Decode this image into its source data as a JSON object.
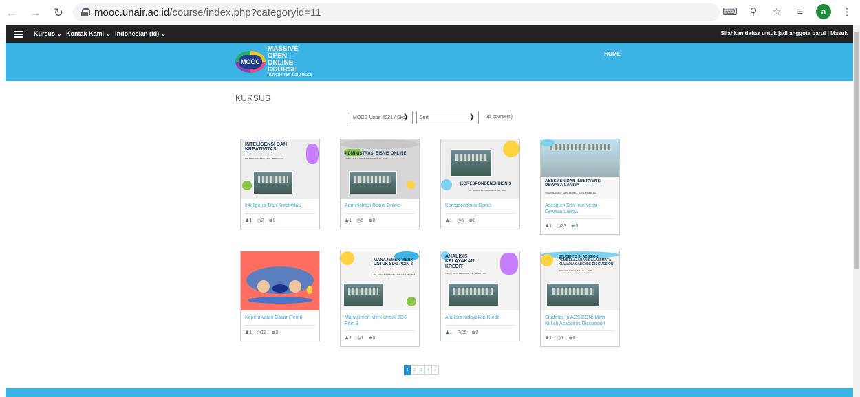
{
  "browser": {
    "url_host": "mooc.unair.ac.id",
    "url_path": "/course/index.php?categoryid=11",
    "profile_initial": "a"
  },
  "topnav": {
    "items": [
      "Kursus ⌄",
      "Kontak Kami ⌄",
      "Indonesian (id) ⌄"
    ],
    "right_text": "Silahkan daftar untuk jadi anggota baru! | Masuk"
  },
  "header": {
    "logo_badge": "MOOC",
    "logo_line1": "MASSIVE OPEN",
    "logo_line2": "ONLINE COURSE",
    "logo_line3": "UNIVERSITAS AIRLANGGA",
    "home_label": "HOME"
  },
  "page": {
    "title": "KURSUS",
    "category_select": "MOOC Unair 2021 / Ske",
    "sort_select": "Sort",
    "course_count": "25 course(s)"
  },
  "courses": [
    {
      "thumb_title": "Inteligensi dan Kreativitas",
      "thumb_sub": "DR. FITRI ANDRIANI, M. SI., PSIKOLOG",
      "name": "Inteligensi Dan Kreativitas",
      "students": "1",
      "lessons": "2",
      "groups": "0",
      "accent": "#c77dff",
      "bg": "#eeeeee"
    },
    {
      "thumb_title": "Administrasi Bisnis Online",
      "thumb_sub": "FIRDA SAVILA, DWI DAMAYANTI, S.Kl., M.M",
      "name": "Administrasi Bisnis Online",
      "students": "1",
      "lessons": "5",
      "groups": "0",
      "accent": "#8bc34a",
      "bg": "#d7d7d7"
    },
    {
      "thumb_title": "Korespondensi Bisnis",
      "thumb_sub": "DR. NURFATIH POR IDABOR, SE., MM",
      "name": "Korespondensi Bisnis",
      "students": "1",
      "lessons": "6",
      "groups": "0",
      "accent": "#ffd23f",
      "bg": "#eeeeee"
    },
    {
      "thumb_title": "Asesmen dan Intervensi Dewasa Lansia",
      "thumb_sub": "YUSUF NAFARAT, MAYA KARTIKA, M.PSI.,PSIKOLOG",
      "name": "Asesmen Dan Intervensi Dewasa Lansia",
      "students": "1",
      "lessons": "23",
      "groups": "0",
      "accent": "#7dd3f0",
      "bg": "#f7f7f7"
    },
    {
      "thumb_title": "",
      "thumb_sub": "",
      "name": "Keperawatan Dasar (Teori)",
      "students": "1",
      "lessons": "12",
      "groups": "0",
      "accent": "#ff6f61",
      "bg": "#ff6f61"
    },
    {
      "thumb_title": "Manajemen Merk untuk SDG Poin 8",
      "thumb_sub": "DR. NURATIH ISNAINI, HIMAWATI, MA, MM",
      "name": "Manajemen Merk Untuk SDG Poin 8",
      "students": "1",
      "lessons": "1",
      "groups": "0",
      "accent": "#3bb3e4",
      "bg": "#f3f3f3"
    },
    {
      "thumb_title": "Analisis Kelayakan Kredit",
      "thumb_sub": "YENNY MAYA CHANDRA, S.E., M.SM.,PHD",
      "name": "Analisis Kelayakan Kredit",
      "students": "1",
      "lessons": "25",
      "groups": "0",
      "accent": "#c77dff",
      "bg": "#f3f3f3"
    },
    {
      "thumb_title": "Students in Acssion: Pembelajaran dalam Mata Kuliah Academic Discussion",
      "thumb_sub": "IKRA NUR NAHLA, S.S., M.A., PHD",
      "name": "Students In ACSSION: Mata Kuliah Academic Discussion",
      "students": "1",
      "lessons": "1",
      "groups": "0",
      "accent": "#7dd3f0",
      "bg": "#f3f3f3"
    }
  ],
  "pagination": {
    "pages": [
      "1",
      "2",
      "3",
      "4",
      "»"
    ],
    "active": "1"
  }
}
